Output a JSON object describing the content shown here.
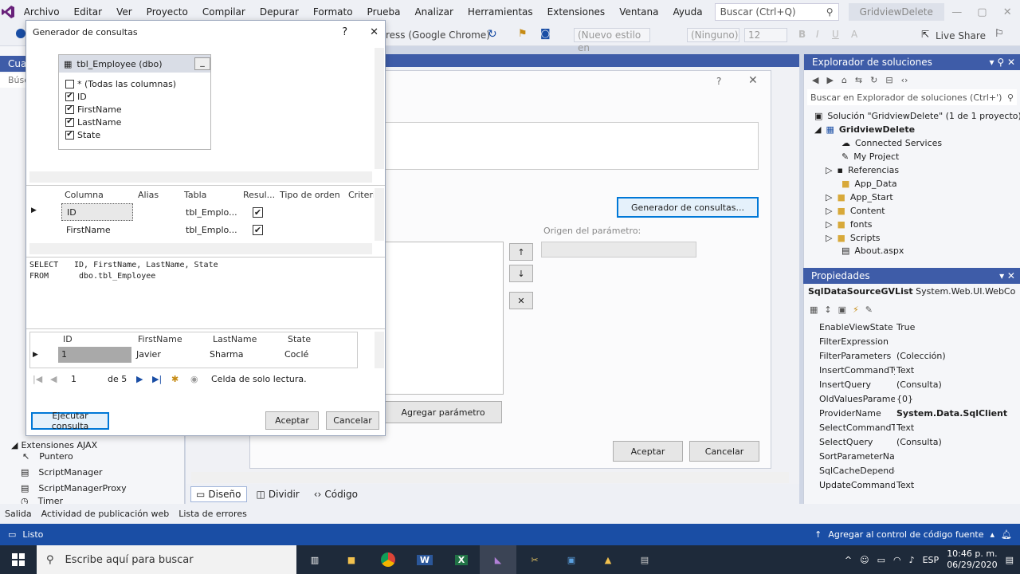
{
  "menubar": {
    "items": [
      "Archivo",
      "Editar",
      "Ver",
      "Proyecto",
      "Compilar",
      "Depurar",
      "Formato",
      "Prueba",
      "Analizar",
      "Herramientas",
      "Extensiones",
      "Ventana",
      "Ayuda"
    ],
    "search_placeholder": "Buscar (Ctrl+Q)",
    "solution_name": "GridviewDelete"
  },
  "toolbar": {
    "browser": "ress (Google Chrome)",
    "style": "(Nuevo estilo en",
    "font": "(Ninguno)",
    "size": "12",
    "live_share": "Live Share"
  },
  "left_panel": {
    "title": "Cua",
    "search": "Búsc",
    "section": "Extensiones AJAX",
    "items": [
      "Puntero",
      "ScriptManager",
      "ScriptManagerProxy",
      "Timer"
    ]
  },
  "query_builder": {
    "title": "Generador de consultas",
    "help": "?",
    "close": "✕",
    "table_name": "tbl_Employee (dbo)",
    "columns": [
      {
        "label": "* (Todas las columnas)",
        "checked": false
      },
      {
        "label": "ID",
        "checked": true
      },
      {
        "label": "FirstName",
        "checked": true
      },
      {
        "label": "LastName",
        "checked": true
      },
      {
        "label": "State",
        "checked": true
      }
    ],
    "grid_headers": [
      "Columna",
      "Alias",
      "Tabla",
      "Resul...",
      "Tipo de orden",
      "Criteri"
    ],
    "grid_rows": [
      {
        "columna": "ID",
        "tabla": "tbl_Emplo..."
      },
      {
        "columna": "FirstName",
        "tabla": "tbl_Emplo..."
      }
    ],
    "sql_select_kw": "SELECT",
    "sql_select": "ID, FirstName, LastName, State",
    "sql_from_kw": "FROM",
    "sql_from": "dbo.tbl_Employee",
    "result_headers": [
      "ID",
      "FirstName",
      "LastName",
      "State"
    ],
    "result_row": {
      "id": "1",
      "first": "Javier",
      "last": "Sharma",
      "state": "Coclé"
    },
    "nav": {
      "current": "1",
      "of": "de 5",
      "status": "Celda de solo lectura."
    },
    "execute": "Ejecutar consulta",
    "accept": "Aceptar",
    "cancel": "Cancelar"
  },
  "wizard": {
    "help": "?",
    "query_builder_btn": "Generador de consultas...",
    "param_source": "Origen del parámetro:",
    "add_param": "Agregar parámetro",
    "accept": "Aceptar",
    "cancel": "Cancelar"
  },
  "designer_tabs": {
    "design": "Diseño",
    "split": "Dividir",
    "code": "Código"
  },
  "solution_explorer": {
    "title": "Explorador de soluciones",
    "search": "Buscar en Explorador de soluciones (Ctrl+')",
    "solution": "Solución \"GridviewDelete\" (1 de 1 proyecto)",
    "project": "GridviewDelete",
    "items": [
      "Connected Services",
      "My Project",
      "Referencias",
      "App_Data",
      "App_Start",
      "Content",
      "fonts",
      "Scripts",
      "About.aspx"
    ]
  },
  "properties": {
    "title": "Propiedades",
    "object": "SqlDataSourceGVList",
    "type": "System.Web.UI.WebContr",
    "rows": [
      {
        "name": "EnableViewState",
        "value": "True"
      },
      {
        "name": "FilterExpression",
        "value": ""
      },
      {
        "name": "FilterParameters",
        "value": "(Colección)"
      },
      {
        "name": "InsertCommandType",
        "value": "Text"
      },
      {
        "name": "InsertQuery",
        "value": "(Consulta)"
      },
      {
        "name": "OldValuesParameterFc",
        "value": "{0}"
      },
      {
        "name": "ProviderName",
        "value": "System.Data.SqlClient"
      },
      {
        "name": "SelectCommandType",
        "value": "Text"
      },
      {
        "name": "SelectQuery",
        "value": "(Consulta)"
      },
      {
        "name": "SortParameterName",
        "value": ""
      },
      {
        "name": "SqlCacheDependency",
        "value": ""
      },
      {
        "name": "UpdateCommandType",
        "value": "Text"
      }
    ]
  },
  "output_tabs": [
    "Salida",
    "Actividad de publicación web",
    "Lista de errores"
  ],
  "status": {
    "left": "Listo",
    "right": "Agregar al control de código fuente"
  },
  "taskbar": {
    "search": "Escribe aquí para buscar",
    "lang": "ESP",
    "time": "10:46 p. m.",
    "date": "06/29/2020"
  },
  "colors": {
    "accent": "#3e5ca8",
    "status": "#1a4ea5",
    "vs_purple": "#68217a"
  }
}
